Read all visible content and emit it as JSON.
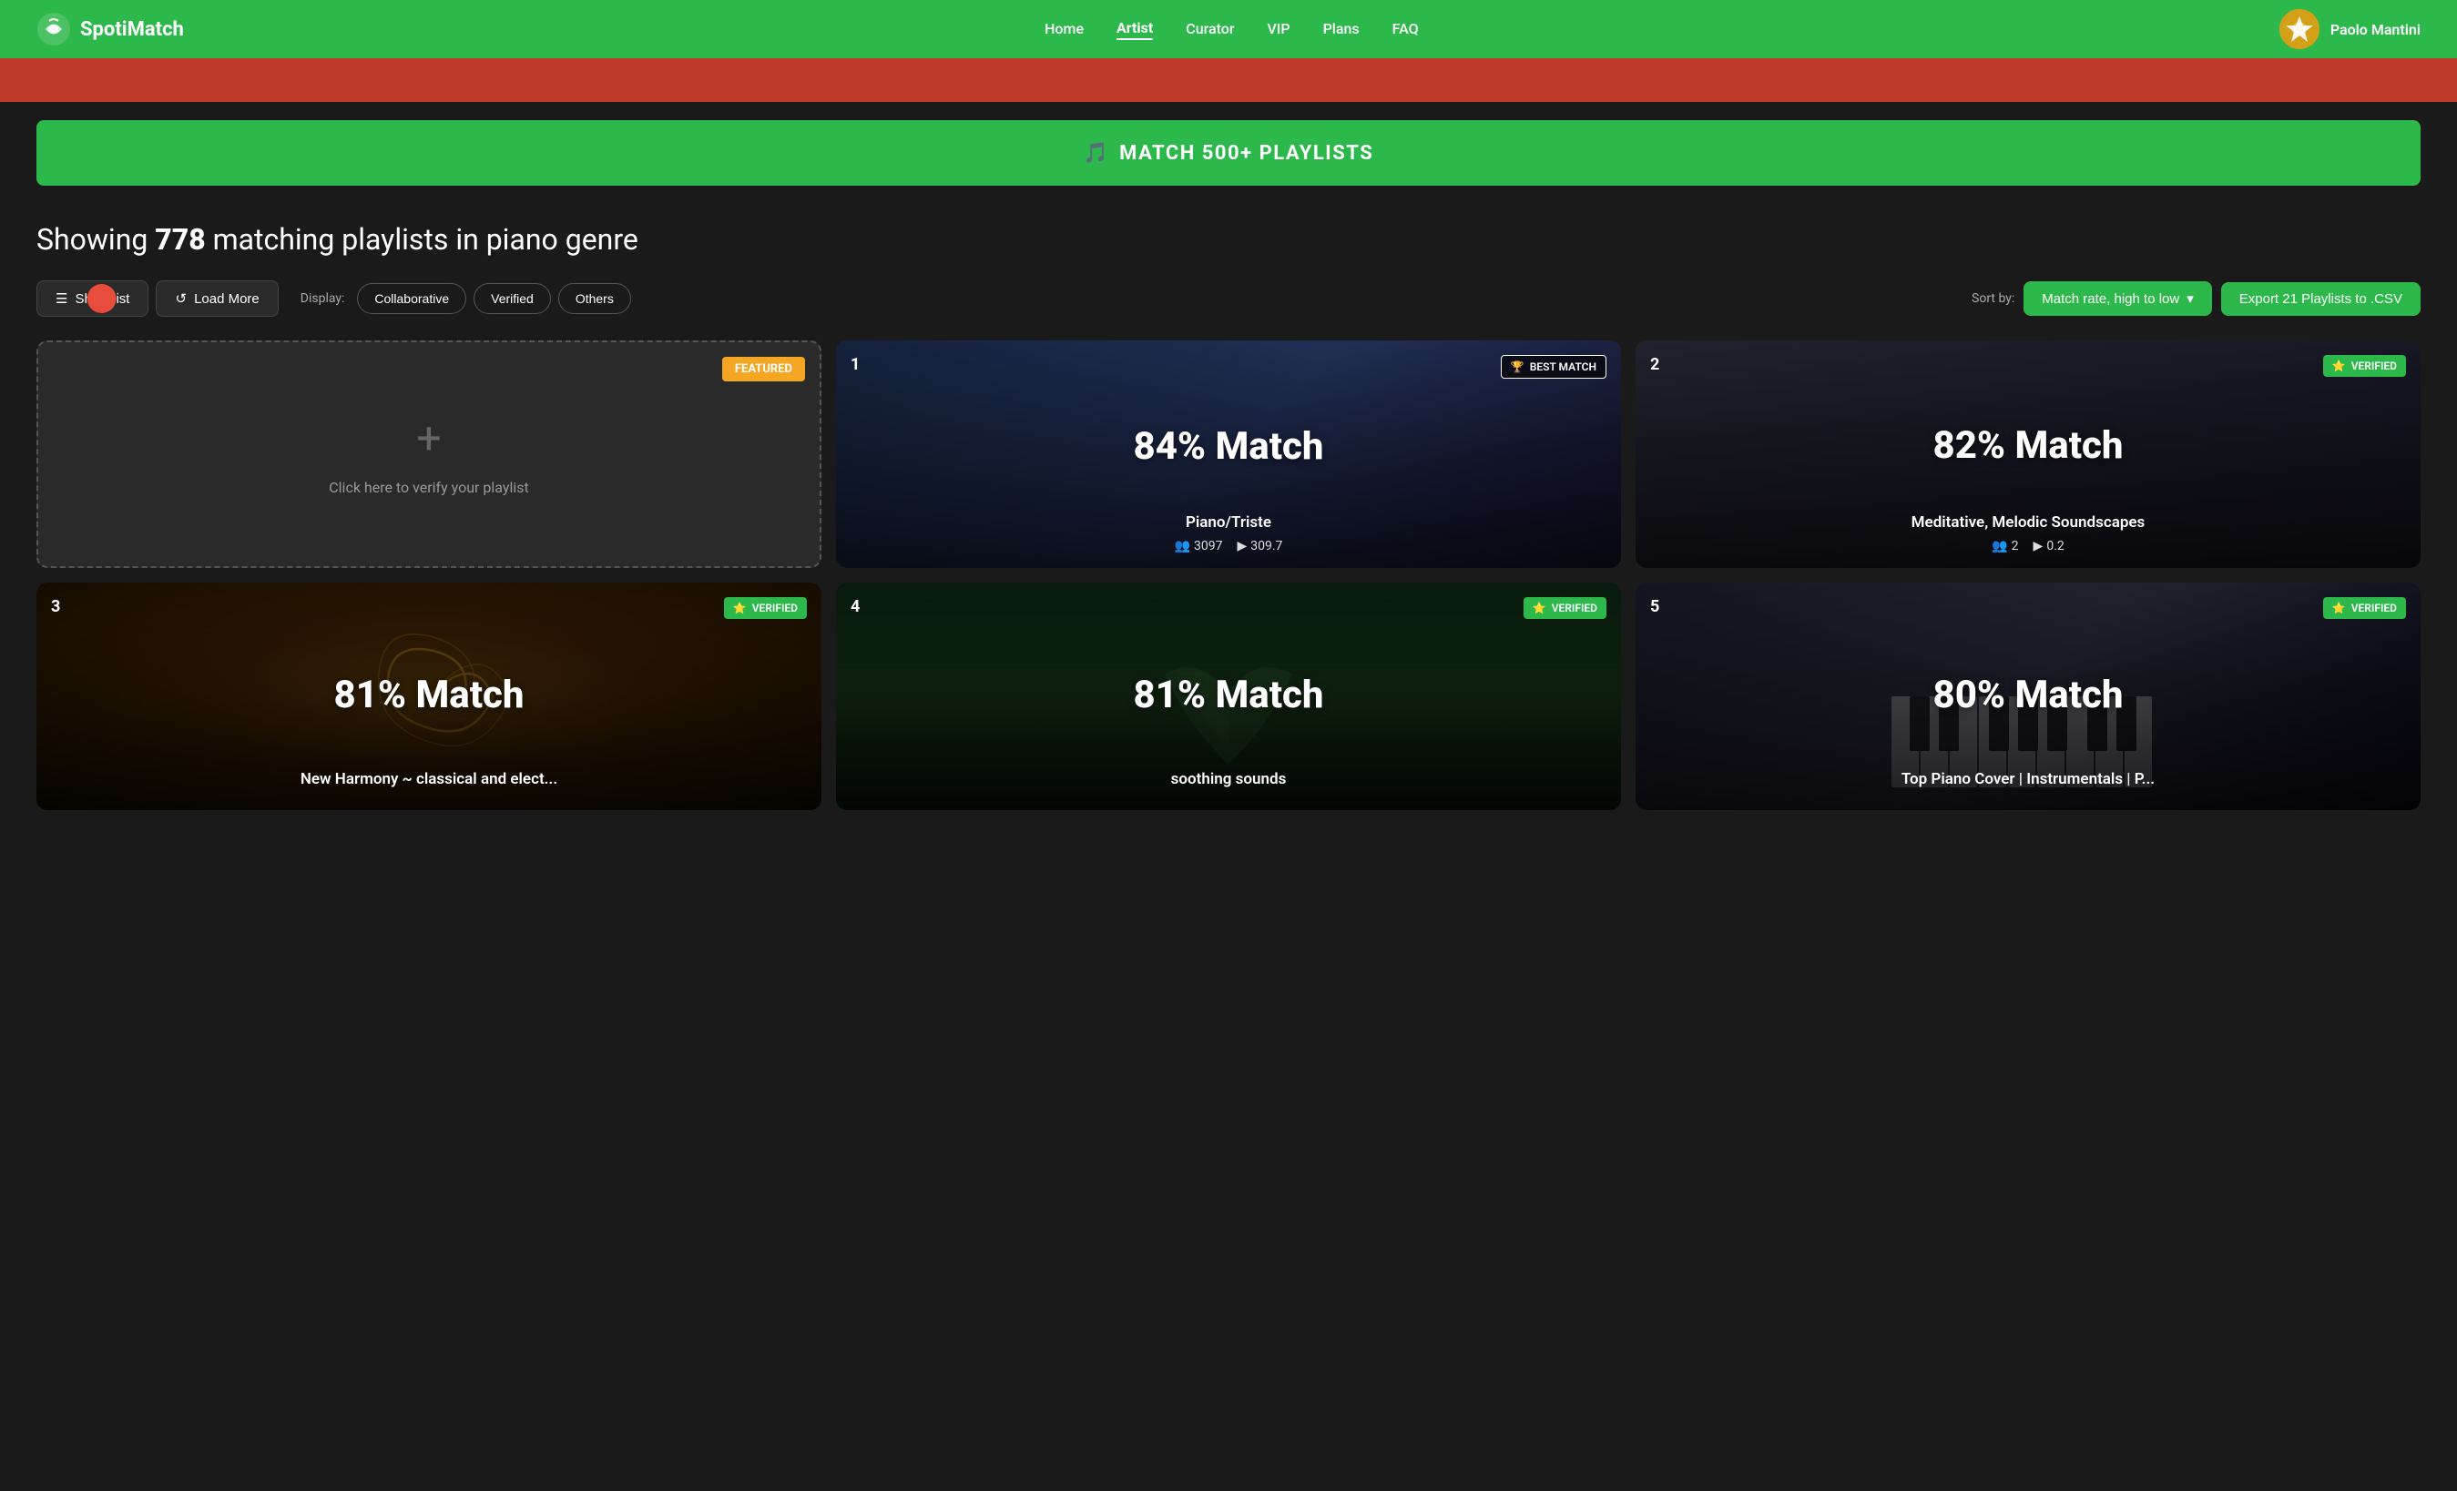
{
  "header": {
    "logo_text": "SpotiMatch",
    "nav_items": [
      {
        "label": "Home",
        "active": false
      },
      {
        "label": "Artist",
        "active": true
      },
      {
        "label": "Curator",
        "active": false
      },
      {
        "label": "VIP",
        "active": false
      },
      {
        "label": "Plans",
        "active": false
      },
      {
        "label": "FAQ",
        "active": false
      }
    ],
    "user_name": "Paolo Mantini"
  },
  "match_banner": {
    "text": "MATCH 500+ PLAYLISTS"
  },
  "page_title": {
    "prefix": "Showing ",
    "count": "778",
    "middle": " matching playlists",
    "suffix": " in piano genre"
  },
  "controls": {
    "show_list_label": "Show list",
    "load_more_label": "Load More",
    "display_label": "Display:",
    "filters": [
      "Collaborative",
      "Verified",
      "Others"
    ],
    "sort_label": "Sort by:",
    "sort_value": "Match rate, high to low",
    "export_label": "Export 21 Playlists to .CSV"
  },
  "cards": [
    {
      "type": "featured",
      "badge": "FEATURED",
      "verify_text": "Click here to verify your playlist"
    },
    {
      "type": "playlist",
      "number": "1",
      "badge": "BEST MATCH",
      "badge_type": "best",
      "match": "84% Match",
      "name": "Piano/Triste",
      "followers": "3097",
      "streams": "309.7",
      "bg": "dark-blue"
    },
    {
      "type": "playlist",
      "number": "2",
      "badge": "VERIFIED",
      "badge_type": "verified",
      "match": "82% Match",
      "name": "Meditative, Melodic Soundscapes",
      "followers": "2",
      "streams": "0.2",
      "bg": "dark-gray"
    },
    {
      "type": "playlist",
      "number": "3",
      "badge": "VERIFIED",
      "badge_type": "verified",
      "match": "81% Match",
      "name": "New Harmony ~ classical and elect...",
      "followers": "",
      "streams": "",
      "bg": "gold"
    },
    {
      "type": "playlist",
      "number": "4",
      "badge": "VERIFIED",
      "badge_type": "verified",
      "match": "81% Match",
      "name": "soothing sounds",
      "followers": "",
      "streams": "",
      "bg": "green-dark"
    },
    {
      "type": "playlist",
      "number": "5",
      "badge": "VERIFIED",
      "badge_type": "verified",
      "match": "80% Match",
      "name": "Top Piano Cover | Instrumentals | P...",
      "followers": "",
      "streams": "",
      "bg": "piano"
    }
  ],
  "icons": {
    "logo": "🎵",
    "list": "☰",
    "refresh": "↺",
    "best_match": "🏆",
    "star": "⭐",
    "followers": "👥",
    "play": "▶",
    "chevron_down": "▾",
    "export_icon": "📤"
  }
}
